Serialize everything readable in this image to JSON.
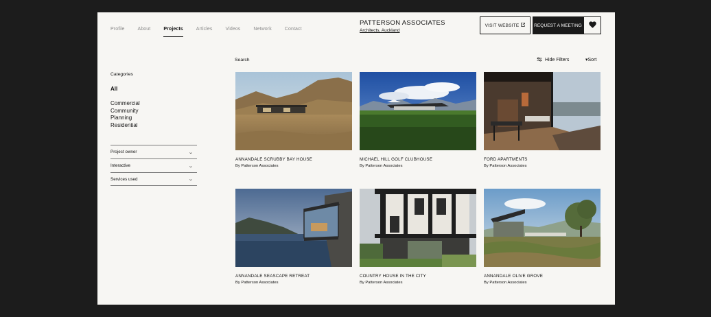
{
  "nav": {
    "items": [
      {
        "label": "Profile",
        "active": false
      },
      {
        "label": "About",
        "active": false
      },
      {
        "label": "Projects",
        "active": true
      },
      {
        "label": "Articles",
        "active": false
      },
      {
        "label": "Videos",
        "active": false
      },
      {
        "label": "Network",
        "active": false
      },
      {
        "label": "Contact",
        "active": false
      }
    ]
  },
  "brand": {
    "name": "PATTERSON ASSOCIATES",
    "subtitle": "Architects, Auckland"
  },
  "actions": {
    "visit_label": "VISIT WEBSITE",
    "meeting_label": "REQUEST A MEETING"
  },
  "sidebar": {
    "categories_title": "Categories",
    "all_label": "All",
    "categories": [
      "Commercial",
      "Community",
      "Planning",
      "Residential"
    ],
    "filters": [
      "Project owner",
      "Interactive",
      "Services used"
    ]
  },
  "toolbar": {
    "search_label": "Search",
    "hide_filters_label": "Hide Filters",
    "sort_label": "▾Sort"
  },
  "projects": [
    {
      "title": "ANNANDALE SCRUBBY BAY HOUSE",
      "by": "By Patterson Associates"
    },
    {
      "title": "MICHAEL HILL GOLF CLUBHOUSE",
      "by": "By Patterson Associates"
    },
    {
      "title": "FORD APARTMENTS",
      "by": "By Patterson Associates"
    },
    {
      "title": "ANNANDALE SEASCAPE RETREAT",
      "by": "By Patterson Associates"
    },
    {
      "title": "COUNTRY HOUSE IN THE CITY",
      "by": "By Patterson Associates"
    },
    {
      "title": "ANNANDALE OLIVE GROVE",
      "by": "By Patterson Associates"
    }
  ],
  "colors": {
    "page_bg": "#f7f6f3",
    "outer_bg": "#1c1c1c",
    "text": "#111111"
  }
}
